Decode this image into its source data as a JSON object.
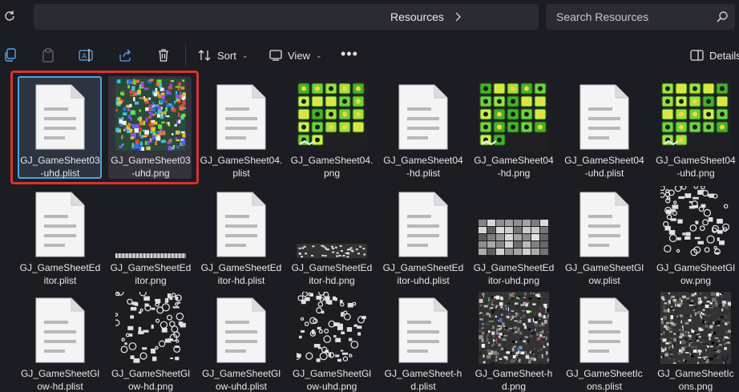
{
  "address": {
    "crumb": "Resources"
  },
  "search": {
    "placeholder": "Search Resources"
  },
  "toolbar": {
    "sort": "Sort",
    "view": "View",
    "details": "Details"
  },
  "colors": {
    "selection_border": "#4fa3e0",
    "highlight_red": "#d9332e",
    "background": "#1c1c23"
  },
  "files": [
    {
      "l1": "GJ_GameSheet03",
      "l2": "-uhd.plist",
      "type": "doc"
    },
    {
      "l1": "GJ_GameSheet03",
      "l2": "-uhd.png",
      "type": "color-dense"
    },
    {
      "l1": "GJ_GameSheet04.",
      "l2": "plist",
      "type": "doc"
    },
    {
      "l1": "GJ_GameSheet04.",
      "l2": "png",
      "type": "green-sheet"
    },
    {
      "l1": "GJ_GameSheet04",
      "l2": "-hd.plist",
      "type": "doc"
    },
    {
      "l1": "GJ_GameSheet04",
      "l2": "-hd.png",
      "type": "green-sheet"
    },
    {
      "l1": "GJ_GameSheet04",
      "l2": "-uhd.plist",
      "type": "doc"
    },
    {
      "l1": "GJ_GameSheet04",
      "l2": "-uhd.png",
      "type": "green-sheet"
    },
    {
      "l1": "GJ_GameSheetEd",
      "l2": "itor.plist",
      "type": "doc"
    },
    {
      "l1": "GJ_GameSheetEd",
      "l2": "itor.png",
      "type": "strip"
    },
    {
      "l1": "GJ_GameSheetEd",
      "l2": "itor-hd.plist",
      "type": "doc"
    },
    {
      "l1": "GJ_GameSheetEd",
      "l2": "itor-hd.png",
      "type": "strip2"
    },
    {
      "l1": "GJ_GameSheetEd",
      "l2": "itor-uhd.plist",
      "type": "doc"
    },
    {
      "l1": "GJ_GameSheetEd",
      "l2": "itor-uhd.png",
      "type": "gray-tiles"
    },
    {
      "l1": "GJ_GameSheetGl",
      "l2": "ow.plist",
      "type": "doc"
    },
    {
      "l1": "GJ_GameSheetGl",
      "l2": "ow.png",
      "type": "white-glyphs"
    },
    {
      "l1": "GJ_GameSheetGl",
      "l2": "ow-hd.plist",
      "type": "doc"
    },
    {
      "l1": "GJ_GameSheetGl",
      "l2": "ow-hd.png",
      "type": "white-glyphs"
    },
    {
      "l1": "GJ_GameSheetGl",
      "l2": "ow-uhd.plist",
      "type": "doc"
    },
    {
      "l1": "GJ_GameSheetGl",
      "l2": "ow-uhd.png",
      "type": "white-glyphs"
    },
    {
      "l1": "GJ_GameSheet-h",
      "l2": "d.plist",
      "type": "doc"
    },
    {
      "l1": "GJ_GameSheet-h",
      "l2": "d.png",
      "type": "noise"
    },
    {
      "l1": "GJ_GameSheetIc",
      "l2": "ons.plist",
      "type": "doc"
    },
    {
      "l1": "GJ_GameSheetIc",
      "l2": "ons.png",
      "type": "noise-gray"
    }
  ]
}
